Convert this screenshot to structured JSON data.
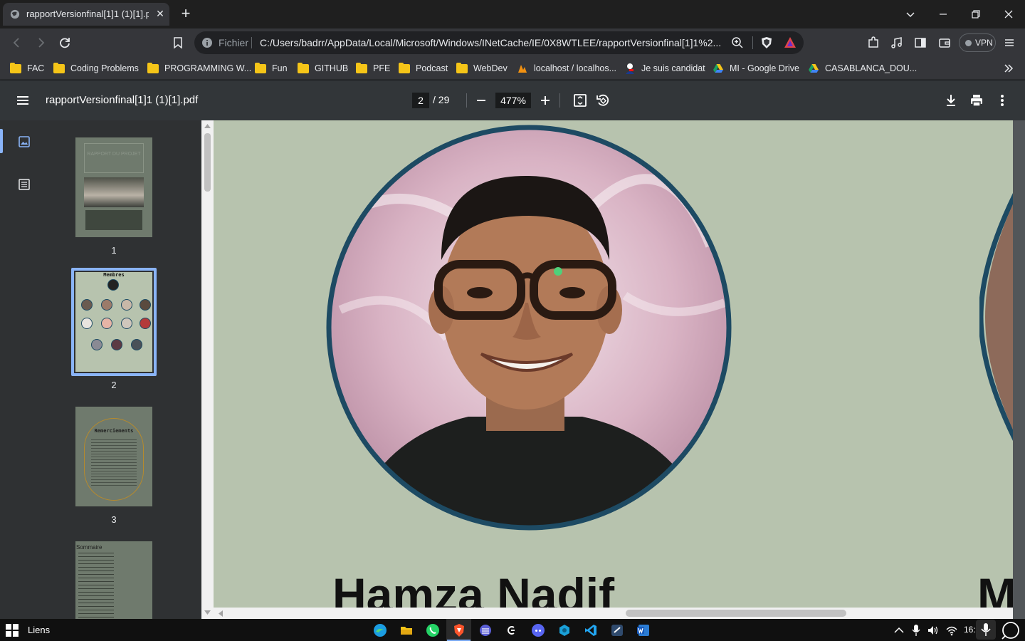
{
  "browser": {
    "tab_title": "rapportVersionfinal[1]1 (1)[1].pdf",
    "omnibox_scheme_label": "Fichier",
    "url": "C:/Users/badrr/AppData/Local/Microsoft/Windows/INetCache/IE/0X8WTLEE/rapportVersionfinal[1]1%2...",
    "vpn_label": "VPN"
  },
  "bookmarks": [
    {
      "label": "FAC",
      "icon": "folder-icon"
    },
    {
      "label": "Coding Problems",
      "icon": "folder-icon"
    },
    {
      "label": "PROGRAMMING W...",
      "icon": "folder-icon"
    },
    {
      "label": "Fun",
      "icon": "folder-icon"
    },
    {
      "label": "GITHUB",
      "icon": "folder-icon"
    },
    {
      "label": "PFE",
      "icon": "folder-icon"
    },
    {
      "label": "Podcast",
      "icon": "folder-icon"
    },
    {
      "label": "WebDev",
      "icon": "folder-icon"
    },
    {
      "label": "localhost / localhos...",
      "icon": "phpmyadmin-icon"
    },
    {
      "label": "Je suis candidat",
      "icon": "candidate-icon"
    },
    {
      "label": "MI - Google Drive",
      "icon": "google-drive-icon"
    },
    {
      "label": "CASABLANCA_DOU...",
      "icon": "google-drive-icon"
    }
  ],
  "pdf": {
    "file_name": "rapportVersionfinal[1]1 (1)[1].pdf",
    "current_page": "2",
    "total_pages": "/ 29",
    "zoom": "477%",
    "thumbnails": [
      {
        "page": "1",
        "text": "RAPPORT DU PROJET"
      },
      {
        "page": "2",
        "text": "Membres"
      },
      {
        "page": "3",
        "text": "Remerciements"
      },
      {
        "page": "",
        "text": "Sommaire"
      }
    ],
    "content": {
      "member_name": "Hamza Nadif",
      "next_member_partial": "M"
    }
  },
  "taskbar": {
    "search_label": "Liens",
    "clock": "16:"
  },
  "colors": {
    "page_background": "#b7c3ae",
    "photo_ring": "#1d4a63",
    "active_thumb_border": "#8ab4f8"
  }
}
